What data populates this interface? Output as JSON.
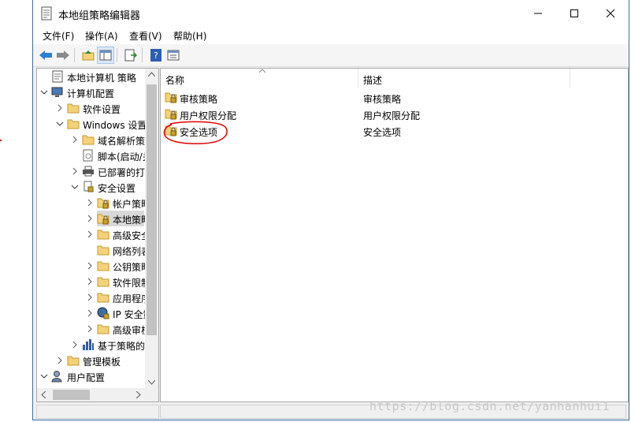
{
  "window": {
    "title": "本地组策略编辑器"
  },
  "menu": [
    "文件(F)",
    "操作(A)",
    "查看(V)",
    "帮助(H)"
  ],
  "toolbar": {
    "buttons": [
      "back-icon",
      "forward-icon",
      "up-folder-icon",
      "show-hide-tree-icon",
      "export-list-icon",
      "help-icon",
      "properties-view-icon"
    ]
  },
  "tree": [
    {
      "label": "本地计算机 策略",
      "icon": "policy-doc-icon",
      "expanded": null,
      "level": 0
    },
    {
      "label": "计算机配置",
      "icon": "computer-icon",
      "expanded": true,
      "level": 0
    },
    {
      "label": "软件设置",
      "icon": "folder-icon",
      "expanded": false,
      "level": 1
    },
    {
      "label": "Windows 设置",
      "icon": "folder-icon",
      "expanded": true,
      "level": 1
    },
    {
      "label": "域名解析策略",
      "icon": "folder-icon",
      "expanded": false,
      "level": 2
    },
    {
      "label": "脚本(启动/关机)",
      "icon": "script-icon",
      "expanded": null,
      "level": 2
    },
    {
      "label": "已部署的打印机",
      "icon": "printer-icon",
      "expanded": false,
      "level": 2
    },
    {
      "label": "安全设置",
      "icon": "security-settings-icon",
      "expanded": true,
      "level": 2
    },
    {
      "label": "帐户策略",
      "icon": "lock-folder-icon",
      "expanded": false,
      "level": 3
    },
    {
      "label": "本地策略",
      "icon": "lock-folder-icon",
      "expanded": false,
      "level": 3,
      "selected": true
    },
    {
      "label": "高级安全 Windows 防火墙",
      "icon": "folder-icon",
      "expanded": false,
      "level": 3
    },
    {
      "label": "网络列表管理器策略",
      "icon": "folder-icon",
      "expanded": null,
      "level": 3
    },
    {
      "label": "公钥策略",
      "icon": "folder-icon",
      "expanded": false,
      "level": 3
    },
    {
      "label": "软件限制策略",
      "icon": "folder-icon",
      "expanded": false,
      "level": 3
    },
    {
      "label": "应用程序控制策略",
      "icon": "folder-icon",
      "expanded": false,
      "level": 3
    },
    {
      "label": "IP 安全策略",
      "icon": "ip-security-icon",
      "expanded": false,
      "level": 3
    },
    {
      "label": "高级审核策略配置",
      "icon": "folder-icon",
      "expanded": false,
      "level": 3
    },
    {
      "label": "基于策略的 QoS",
      "icon": "bar-chart-icon",
      "expanded": false,
      "level": 2
    },
    {
      "label": "管理模板",
      "icon": "folder-icon",
      "expanded": false,
      "level": 1
    },
    {
      "label": "用户配置",
      "icon": "user-icon",
      "expanded": true,
      "level": 0
    }
  ],
  "list": {
    "columns": [
      "名称",
      "描述"
    ],
    "rows": [
      {
        "name": "审核策略",
        "description": "审核策略"
      },
      {
        "name": "用户权限分配",
        "description": "用户权限分配"
      },
      {
        "name": "安全选项",
        "description": "安全选项",
        "annotated": true
      }
    ]
  },
  "watermark": "https://blog.csdn.net/yanhanhui1",
  "colors": {
    "annotation": "#e00000",
    "folder": "#f5d27a",
    "accent": "#3b6ea5"
  }
}
